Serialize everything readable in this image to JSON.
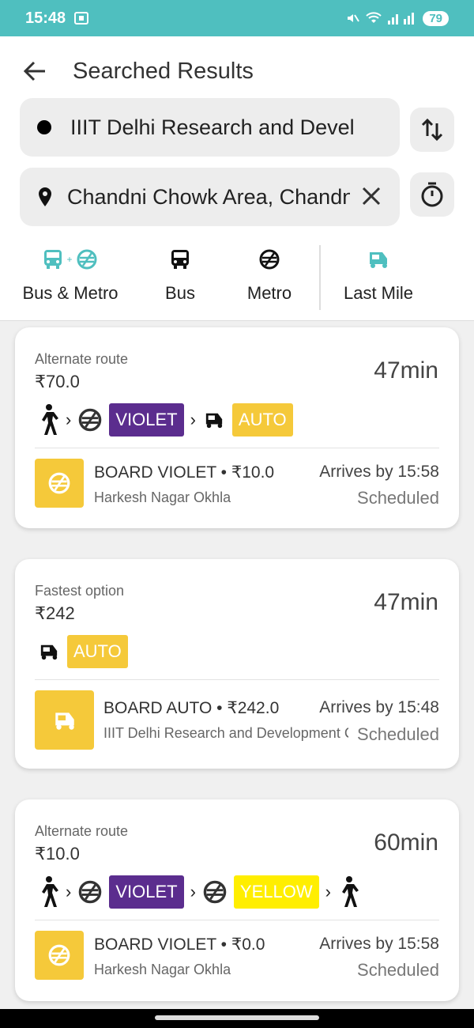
{
  "status": {
    "time": "15:48",
    "battery": "79"
  },
  "header": {
    "title": "Searched Results"
  },
  "search": {
    "origin": "IIIT Delhi Research and Development Centre",
    "destination": "Chandni Chowk Area, Chandni Chowk"
  },
  "modes": [
    {
      "label": "Bus & Metro",
      "icon": "bus-metro-icon"
    },
    {
      "label": "Bus",
      "icon": "bus-icon"
    },
    {
      "label": "Metro",
      "icon": "metro-icon"
    },
    {
      "label": "Last Mile",
      "icon": "auto-rickshaw-icon"
    }
  ],
  "colors": {
    "teal": "#4fbfbf",
    "violet": "#5b2d8e",
    "yellow": "#ffee00",
    "auto": "#f5c93a"
  },
  "cards": [
    {
      "type": "Alternate route",
      "price": "₹70.0",
      "duration": "47min",
      "route": [
        "walk",
        "metro",
        "VIOLET",
        "auto",
        "AUTO"
      ],
      "violet_label": "VIOLET",
      "auto_label": "AUTO",
      "board": "BOARD VIOLET • ₹10.0",
      "stop": "Harkesh Nagar Okhla",
      "arrives": "Arrives by 15:58",
      "status": "Scheduled"
    },
    {
      "type": "Fastest option",
      "price": "₹242",
      "duration": "47min",
      "auto_label": "AUTO",
      "board": "BOARD AUTO • ₹242.0",
      "stop": "IIIT Delhi Research and Development Centre",
      "arrives": "Arrives by 15:48",
      "status": "Scheduled"
    },
    {
      "type": "Alternate route",
      "price": "₹10.0",
      "duration": "60min",
      "violet_label": "VIOLET",
      "yellow_label": "YELLOW",
      "board": "BOARD VIOLET • ₹0.0",
      "stop": "Harkesh Nagar Okhla",
      "arrives": "Arrives by 15:58",
      "status": "Scheduled"
    }
  ]
}
